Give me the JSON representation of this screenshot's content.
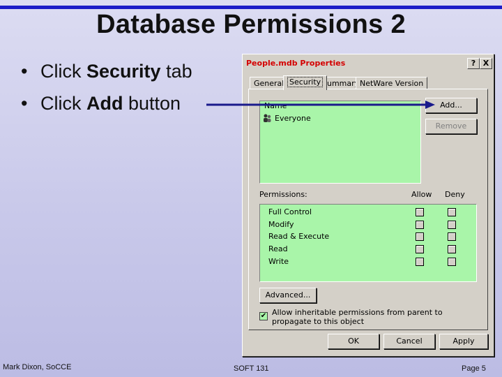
{
  "slide": {
    "title": "Database Permissions 2",
    "bullets": [
      {
        "pre": "Click ",
        "bold": "Security",
        "post": " tab"
      },
      {
        "pre": "Click ",
        "bold": "Add",
        "post": " button"
      }
    ],
    "footer_left": "Mark Dixon, SoCCE",
    "footer_center": "SOFT 131",
    "footer_right": "Page 5"
  },
  "dialog": {
    "title": "People.mdb Properties",
    "help_label": "?",
    "close_label": "X",
    "tabs": [
      "General",
      "Security",
      "Summary",
      "NetWare Version"
    ],
    "active_tab": "Security",
    "names_header": "Name",
    "users": [
      {
        "name": "Everyone",
        "icon": "users-group-icon"
      }
    ],
    "add_label": "Add...",
    "remove_label": "Remove",
    "permissions_label": "Permissions:",
    "allow_label": "Allow",
    "deny_label": "Deny",
    "permissions": [
      {
        "name": "Full Control",
        "allow": false,
        "deny": false
      },
      {
        "name": "Modify",
        "allow": false,
        "deny": false
      },
      {
        "name": "Read & Execute",
        "allow": false,
        "deny": false
      },
      {
        "name": "Read",
        "allow": false,
        "deny": false
      },
      {
        "name": "Write",
        "allow": false,
        "deny": false
      }
    ],
    "advanced_label": "Advanced...",
    "inherit_checked": true,
    "inherit_label": "Allow inheritable permissions from parent to propagate to this object",
    "ok_label": "OK",
    "cancel_label": "Cancel",
    "apply_label": "Apply"
  },
  "colors": {
    "title_rule": "#1c1cc8",
    "arrow": "#1a1a8c",
    "list_background": "#a9f5a9",
    "dialog_title": "#d40000"
  }
}
